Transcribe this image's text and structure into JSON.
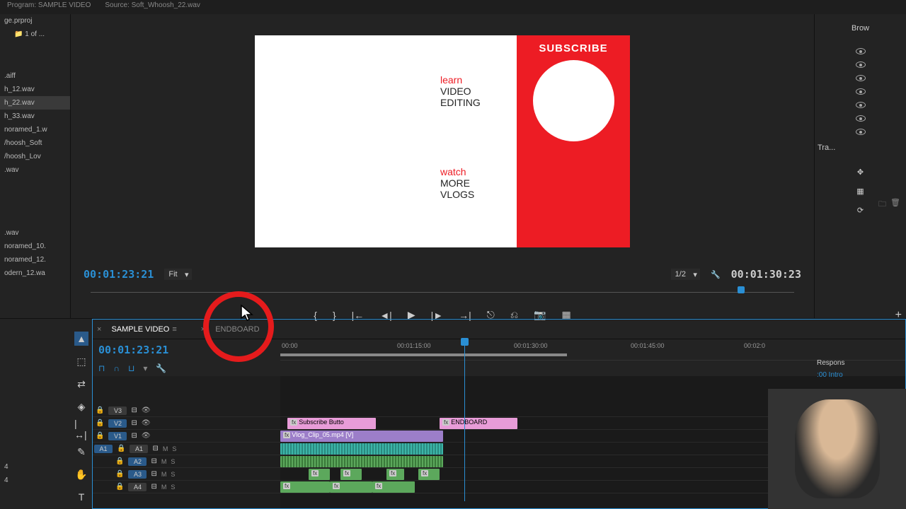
{
  "top": {
    "program_label": "Program: SAMPLE VIDEO",
    "source_label": "Source: Soft_Whoosh_22.wav"
  },
  "project_file": "ge.prproj",
  "bin_count": "1 of ...",
  "files": [
    ".aiff",
    "h_12.wav",
    "h_22.wav",
    "h_33.wav",
    "noramed_1.w",
    "/hoosh_Soft",
    "/hoosh_Lov",
    ".wav",
    ".wav",
    "noramed_10.",
    "noramed_12.",
    "odern_12.wa",
    "4",
    "4"
  ],
  "right": {
    "brow": "Brow",
    "tra": "Tra...",
    "respons": "Respons",
    "intro": ":00 Intro"
  },
  "preview": {
    "learn": "learn",
    "video": "VIDEO",
    "editing": "EDITING",
    "watch": "watch",
    "more": "MORE",
    "vlogs": "VLOGS",
    "subscribe": "SUBSCRIBE"
  },
  "transport": {
    "timecode_left": "00:01:23:21",
    "fit": "Fit",
    "res": "1/2",
    "timecode_right": "00:01:30:23"
  },
  "timeline": {
    "tab1": "SAMPLE VIDEO",
    "tab2": "ENDBOARD",
    "timecode": "00:01:23:21",
    "ruler": [
      "00:00",
      "00:01:15:00",
      "00:01:30:00",
      "00:01:45:00",
      "00:02:0"
    ],
    "v_tracks": [
      "V3",
      "V2",
      "V1"
    ],
    "a_tracks": [
      "A1",
      "A2",
      "A3",
      "A4"
    ],
    "clip_subscribe": "Subscribe Butto",
    "clip_endboard": "ENDBOARD",
    "clip_vlog": "Vlog_Clip_05.mp4 [V]",
    "fx": "fx"
  }
}
